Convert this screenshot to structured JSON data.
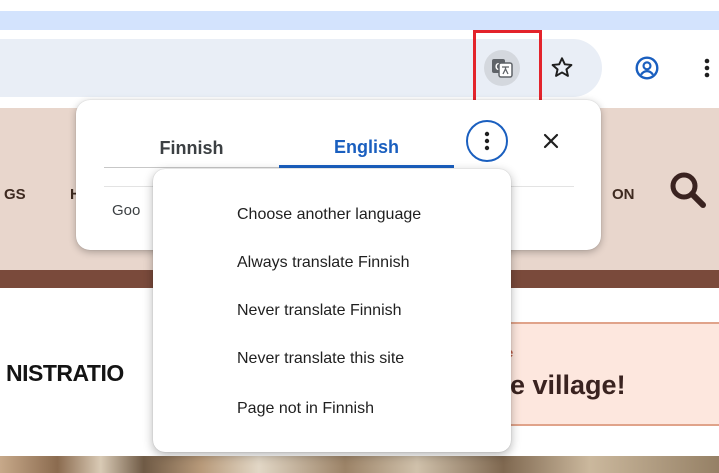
{
  "toolbar": {
    "translate_icon": "translate-icon",
    "star_icon": "star-icon",
    "profile_icon": "profile-icon",
    "menu_icon": "more-vert-icon"
  },
  "site": {
    "nav_left_fragment": "GS",
    "nav_left_fragment2": "H",
    "nav_right_fragment": "ON",
    "headline_fragment": "NISTRATIO",
    "card_sub_fragment": "e",
    "card_text_fragment": "e village!"
  },
  "translate_bubble": {
    "tabs": [
      {
        "label": "Finnish",
        "selected": false
      },
      {
        "label": "English",
        "selected": true
      }
    ],
    "options_icon": "more-vert-icon",
    "close_icon": "close-icon",
    "google_fragment": "Goo"
  },
  "options_menu": {
    "items": [
      {
        "label": "Choose another language"
      },
      {
        "label": "Always translate Finnish"
      },
      {
        "label": "Never translate Finnish"
      },
      {
        "label": "Never translate this site"
      },
      {
        "label": "Page not in Finnish"
      }
    ]
  },
  "colors": {
    "accent": "#1a5fbf",
    "highlight": "#e3232b",
    "site_nav": "#e8d6cc",
    "site_band": "#7a4a3b"
  }
}
